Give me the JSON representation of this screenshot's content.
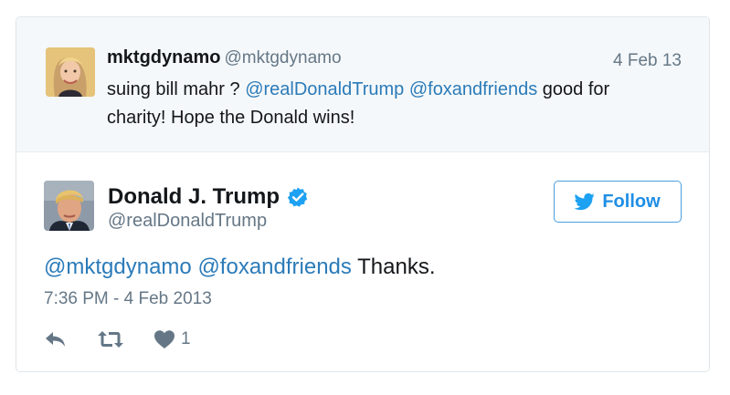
{
  "parent_tweet": {
    "display_name": "mktgdynamo",
    "screen_name": "@mktgdynamo",
    "date": "4 Feb 13",
    "text_parts": [
      {
        "text": "suing bill mahr ? "
      },
      {
        "text": "@realDonaldTrump",
        "mention": true
      },
      {
        "text": " "
      },
      {
        "text": "@foxandfriends",
        "mention": true
      },
      {
        "text": " good for charity! Hope the Donald wins!"
      }
    ],
    "avatar_icon": "blonde-woman-avatar"
  },
  "main_tweet": {
    "display_name": "Donald J. Trump",
    "screen_name": "@realDonaldTrump",
    "verified_icon": "verified-badge-icon",
    "avatar_icon": "man-suit-avatar",
    "follow_label": "Follow",
    "text_parts": [
      {
        "text": "@mktgdynamo",
        "mention": true
      },
      {
        "text": " "
      },
      {
        "text": "@foxandfriends",
        "mention": true
      },
      {
        "text": " Thanks."
      }
    ],
    "timestamp": "7:36 PM - 4 Feb 2013",
    "like_count": "1"
  },
  "colors": {
    "link": "#2b7bb9",
    "secondary_text": "#657786",
    "primary_text": "#14171a",
    "parent_bg": "#f5f8fa",
    "follow_border": "#4a9fdf",
    "verified": "#1da1f2"
  }
}
